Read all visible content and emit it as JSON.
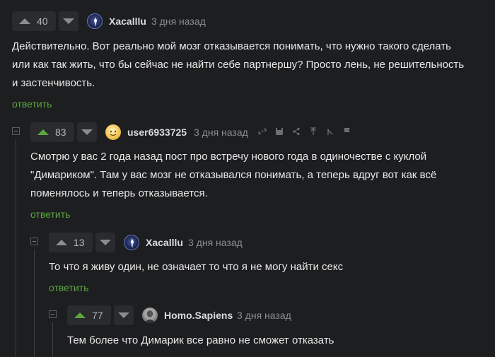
{
  "comments": [
    {
      "rating": "40",
      "user": "Xacalllu",
      "time": "3 дня назад",
      "lines": [
        "Действительно. Вот реально мой мозг отказывается понимать, что нужно такого сделать",
        "или как так жить, что бы сейчас не найти себе партнершу? Просто лень, не решительность",
        "и застенчивость."
      ],
      "reply_label": "ответить"
    },
    {
      "rating": "83",
      "user": "user6933725",
      "time": "3 дня назад",
      "lines": [
        "Смотрю у вас 2 года назад пост про встречу нового года в одиночестве с куклой",
        "\"Димариком\". Там у вас мозг не отказывался понимать, а теперь вдруг вот как всё",
        "поменялось и теперь отказывается."
      ],
      "reply_label": "ответить",
      "tool_icons": [
        "link-icon",
        "save-icon",
        "share-icon",
        "to-parent-icon",
        "branch-icon",
        "report-flag-icon"
      ]
    },
    {
      "rating": "13",
      "user": "Xacalllu",
      "time": "3 дня назад",
      "lines": [
        "То что я живу один, не означает то что я не могу найти секс"
      ],
      "reply_label": "ответить"
    },
    {
      "rating": "77",
      "user": "Homo.Sapiens",
      "time": "3 дня назад",
      "lines": [
        "Тем более что Димарик все равно не сможет отказать"
      ]
    }
  ],
  "colors": {
    "background": "#1d1e20",
    "accent_green": "#5aa73d",
    "text": "#e8e8e8",
    "muted": "#8a8c8f"
  }
}
